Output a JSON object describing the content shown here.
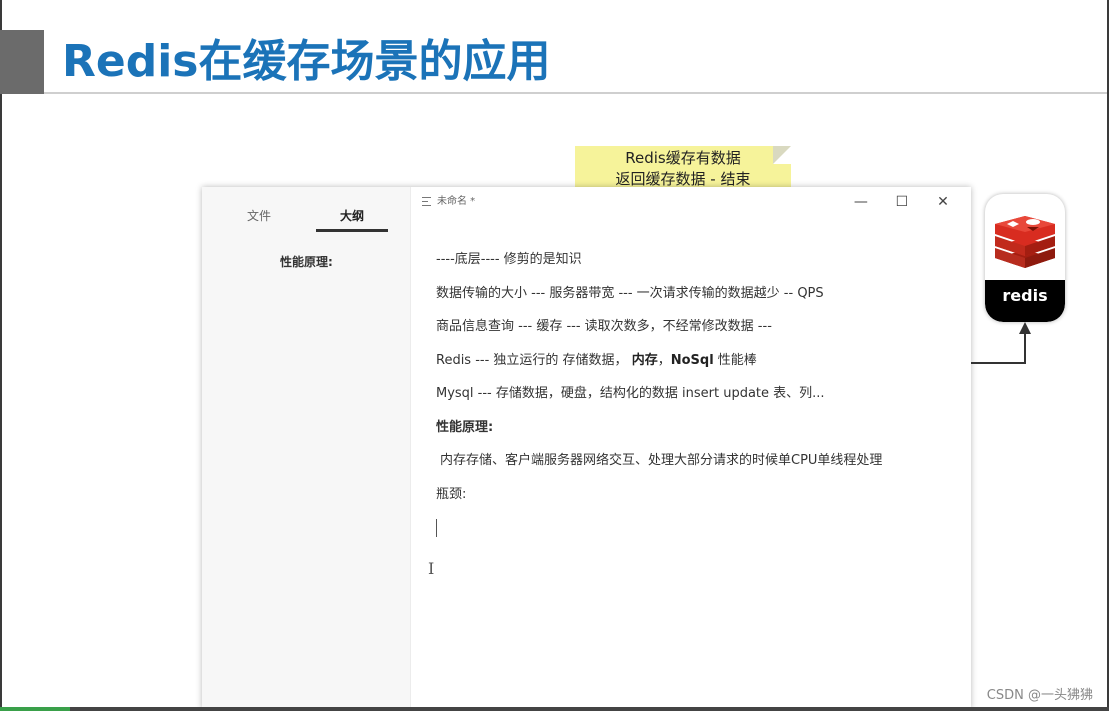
{
  "slide": {
    "title": "Redis在缓存场景的应用",
    "watermark": "CSDN @一头狒狒"
  },
  "sticky_note": {
    "line1": "Redis缓存有数据",
    "line2": "返回缓存数据 - 结束"
  },
  "editor": {
    "doc_title": "未命名 *",
    "window_controls": {
      "minimize": "—",
      "maximize": "☐",
      "close": "✕"
    },
    "sidebar": {
      "tabs": [
        {
          "label": "文件"
        },
        {
          "label": "大纲"
        }
      ],
      "active_tab": "大纲",
      "outline_items": [
        {
          "label": "性能原理:"
        }
      ]
    },
    "lines": [
      {
        "text": "----底层---- 修剪的是知识"
      },
      {
        "text": "数据传输的大小 --- 服务器带宽 --- 一次请求传输的数据越少 -- QPS"
      },
      {
        "text": "商品信息查询 --- 缓存 --- 读取次数多，不经常修改数据 ---"
      },
      {
        "text_a": "Redis --- 独立运行的 存储数据，",
        "bold_a": "内存",
        "sep": "，",
        "bold_b": "NoSql",
        "text_b": " 性能棒"
      },
      {
        "text": "Mysql --- 存储数据，硬盘，结构化的数据 insert update 表、列..."
      },
      {
        "text": "性能原理:"
      },
      {
        "text": "内存存储、客户端服务器网络交互、处理大部分请求的时候单CPU单线程处理"
      },
      {
        "text": "瓶颈:"
      }
    ]
  },
  "redis_logo": {
    "label": "redis",
    "brand_color": "#d82c20"
  }
}
